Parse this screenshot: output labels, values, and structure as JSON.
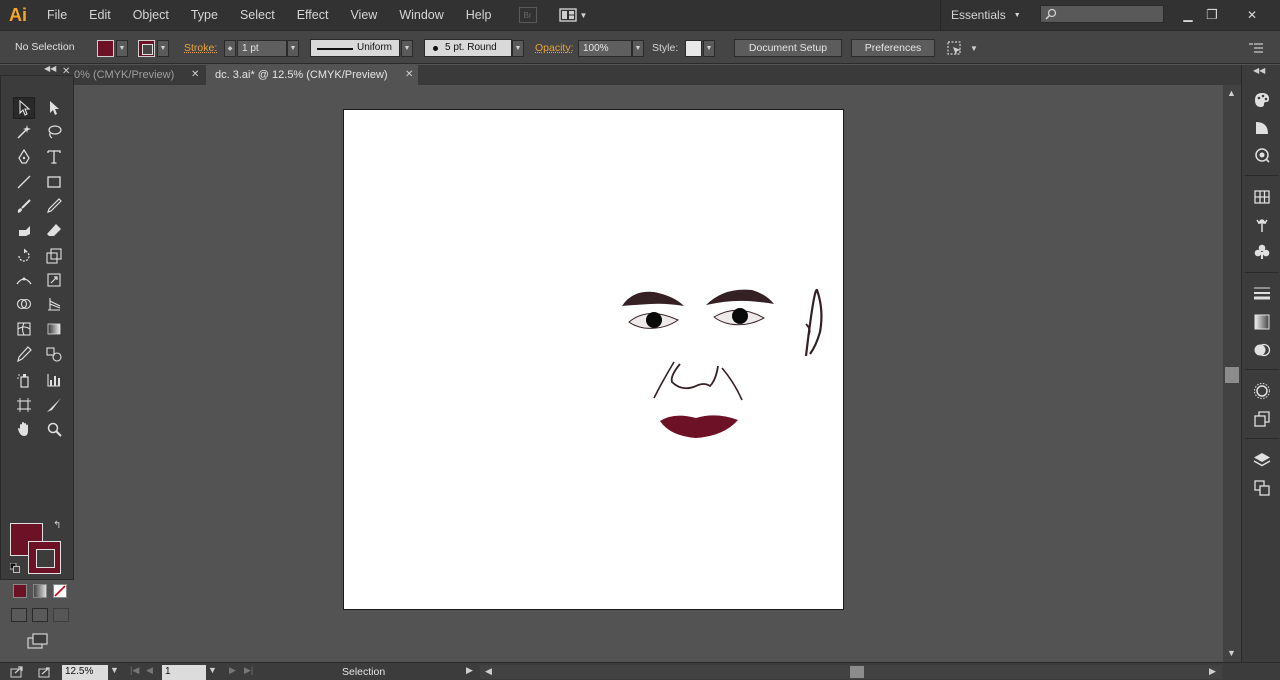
{
  "app": {
    "logo": "Ai"
  },
  "menu": {
    "items": [
      "File",
      "Edit",
      "Object",
      "Type",
      "Select",
      "Effect",
      "View",
      "Window",
      "Help"
    ]
  },
  "header": {
    "bridge_label": "Br",
    "workspace": "Essentials"
  },
  "controlbar": {
    "selection_status": "No Selection",
    "stroke_label": "Stroke:",
    "stroke_weight": "1 pt",
    "profile": "Uniform",
    "brush": "5 pt. Round",
    "opacity_label": "Opacity:",
    "opacity_value": "100%",
    "style_label": "Style:",
    "document_setup": "Document Setup",
    "preferences": "Preferences"
  },
  "tabs": [
    {
      "label": "0% (CMYK/Preview)",
      "active": false
    },
    {
      "label": "dc. 3.ai* @ 12.5% (CMYK/Preview)",
      "active": true
    }
  ],
  "colors": {
    "fill": "#6d1126",
    "stroke": "#6d1126",
    "accent": "#e8a23d"
  },
  "status": {
    "zoom": "12.5%",
    "artboard": "1",
    "current_tool": "Selection"
  }
}
